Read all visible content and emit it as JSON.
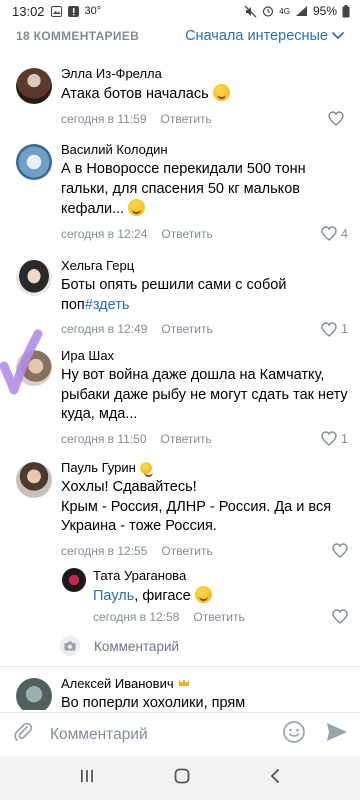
{
  "status_bar": {
    "time": "13:02",
    "temp": "30°",
    "network": "4G",
    "battery": "95%"
  },
  "header": {
    "count": "18 КОММЕНТАРИЕВ",
    "sort": "Сначала интересные"
  },
  "comments": [
    {
      "author": "Элла Из-Фрелла",
      "text": "Атака ботов началась",
      "time": "сегодня в 11:59",
      "reply": "Ответить",
      "likes": "",
      "avatar_color": "#5a3a2a"
    },
    {
      "author": "Василий Колодин",
      "text": "А в Новороссе перекидали 500 тонн гальки, для спасения 50 кг мальков кефали...",
      "time": "сегодня в 12:24",
      "reply": "Ответить",
      "likes": "4",
      "avatar_color": "#6fa0c8"
    },
    {
      "author": "Хельга Герц",
      "text_pre": "Боты опять решили сами с собой поп",
      "text_link": "#здеть",
      "time": "сегодня в 12:49",
      "reply": "Ответить",
      "likes": "1",
      "avatar_color": "#3a3a3a"
    },
    {
      "author": "Ира Шах",
      "text": "Ну вот война даже дошла на Камчатку, рыбаки даже рыбу не могут сдать так нету куда, мда...",
      "time": "сегодня в 11:50",
      "reply": "Ответить",
      "likes": "1",
      "avatar_color": "#b0a090"
    },
    {
      "author": "Пауль Гурин",
      "text": "Хохлы! Сдавайтесь!\nКрым - Россия, ДЛНР - Россия. Да и вся Украина - тоже Россия.",
      "time": "сегодня в 12:55",
      "reply": "Ответить",
      "likes": "",
      "avatar_color": "#8a6a50"
    }
  ],
  "sub_reply": {
    "author": "Тата Ураганова",
    "mention": "Пауль",
    "text": ", фигасе",
    "time": "сегодня в 12:58",
    "reply": "Ответить",
    "avatar_color": "#d02050"
  },
  "reply_input": {
    "placeholder": "Комментарий"
  },
  "last_comment": {
    "author": "Алексей Иванович",
    "text": "Во поперли хохолики, прям",
    "avatar_color": "#607070"
  },
  "composer": {
    "placeholder": "Комментарий"
  },
  "colors": {
    "accent": "#2a6fb5",
    "meta": "#818c99",
    "purple_stroke": "#b48ee8"
  }
}
